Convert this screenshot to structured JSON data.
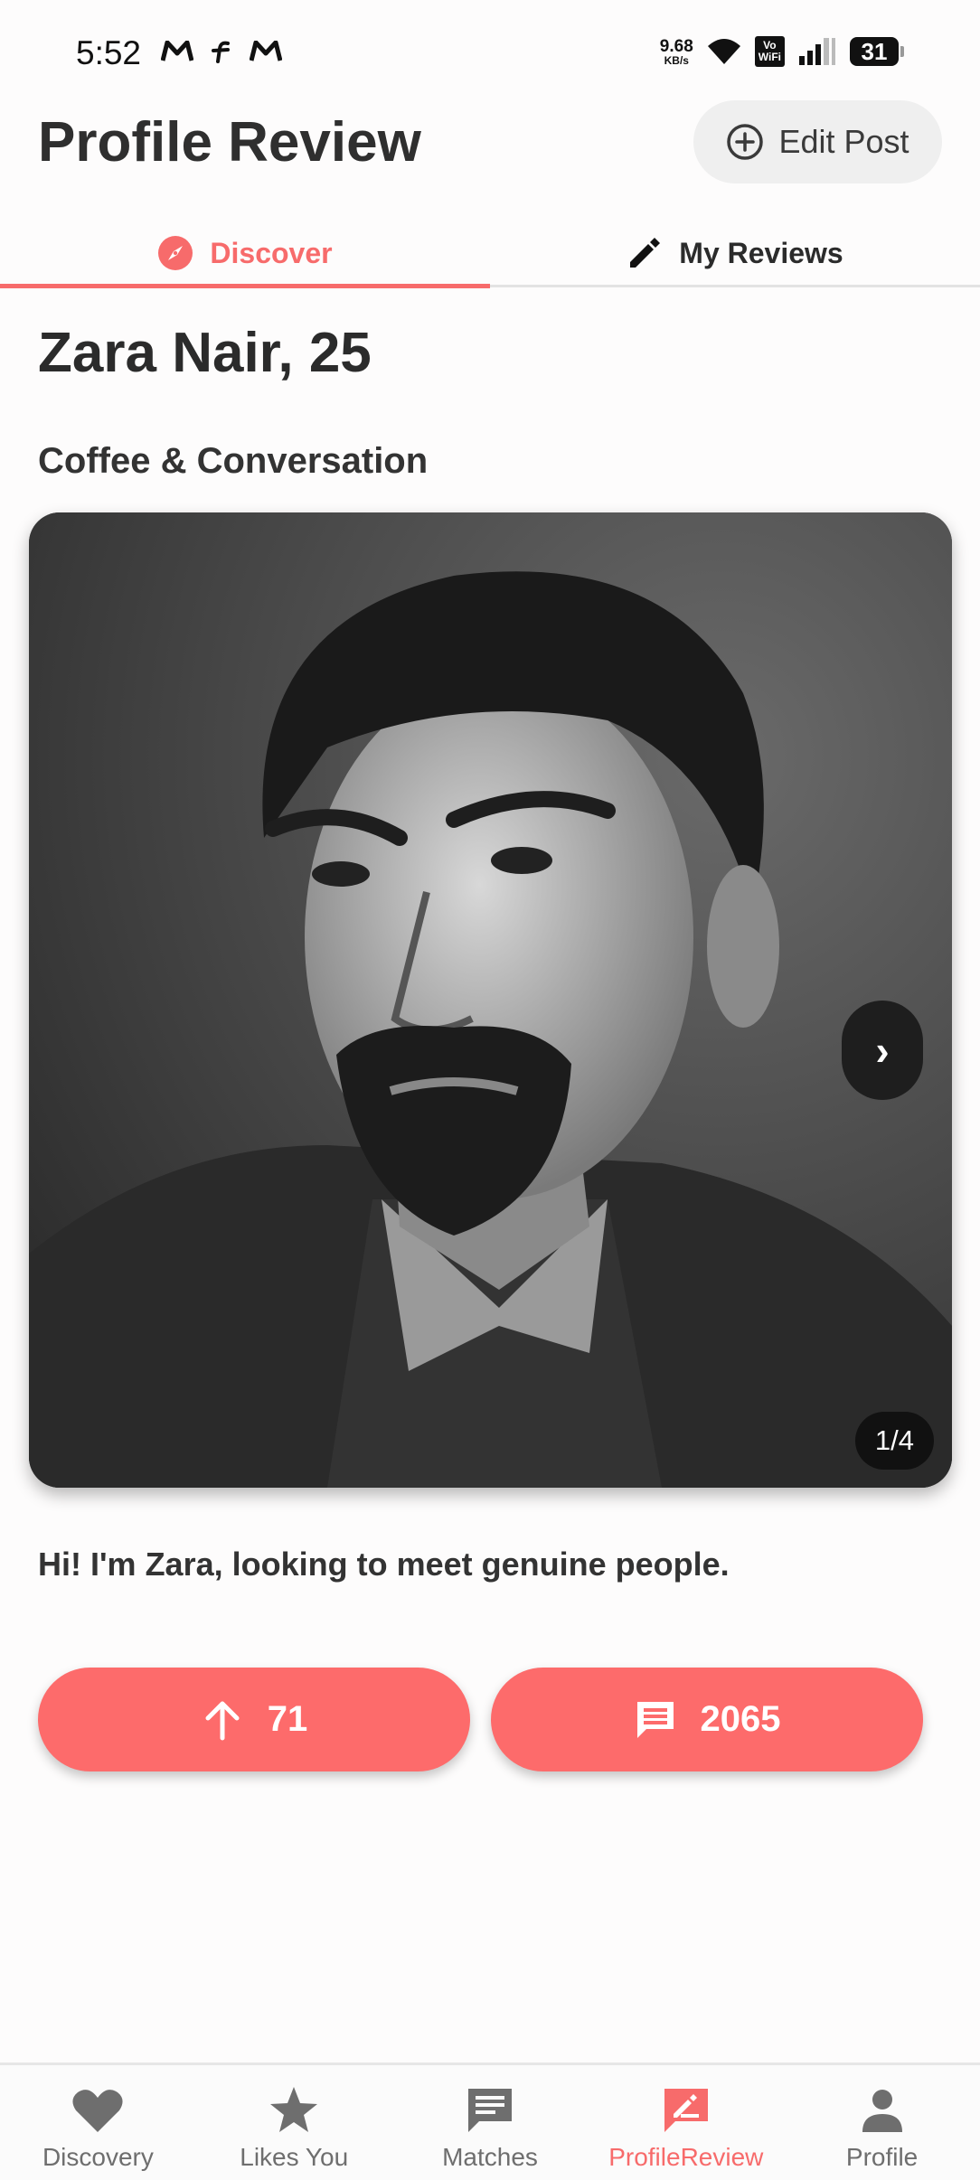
{
  "status_bar": {
    "time": "5:52",
    "net_speed_value": "9.68",
    "net_speed_unit": "KB/s",
    "vowifi_line1": "Vo",
    "vowifi_line2": "WiFi",
    "battery": "31"
  },
  "header": {
    "title": "Profile Review",
    "edit_post_label": "Edit Post"
  },
  "tabs": [
    {
      "label": "Discover",
      "icon": "compass-icon",
      "active": true
    },
    {
      "label": "My Reviews",
      "icon": "pencil-icon",
      "active": false
    }
  ],
  "profile": {
    "name_age": "Zara Nair, 25",
    "post_title": "Coffee & Conversation",
    "photo_counter": "1/4",
    "next_glyph": "›",
    "bio": "Hi! I'm Zara, looking to meet genuine people."
  },
  "actions": {
    "upvotes": "71",
    "comments": "2065"
  },
  "bottom_nav": [
    {
      "label": "Discovery",
      "icon": "heart-icon",
      "active": false
    },
    {
      "label": "Likes You",
      "icon": "star-icon",
      "active": false
    },
    {
      "label": "Matches",
      "icon": "chat-icon",
      "active": false
    },
    {
      "label": "ProfileReview",
      "icon": "review-icon",
      "active": true
    },
    {
      "label": "Profile",
      "icon": "person-icon",
      "active": false
    }
  ],
  "colors": {
    "accent": "#f76b6b",
    "button": "#fd6b6b",
    "text": "#2b2b2b",
    "inactive": "#6e6e6e"
  }
}
